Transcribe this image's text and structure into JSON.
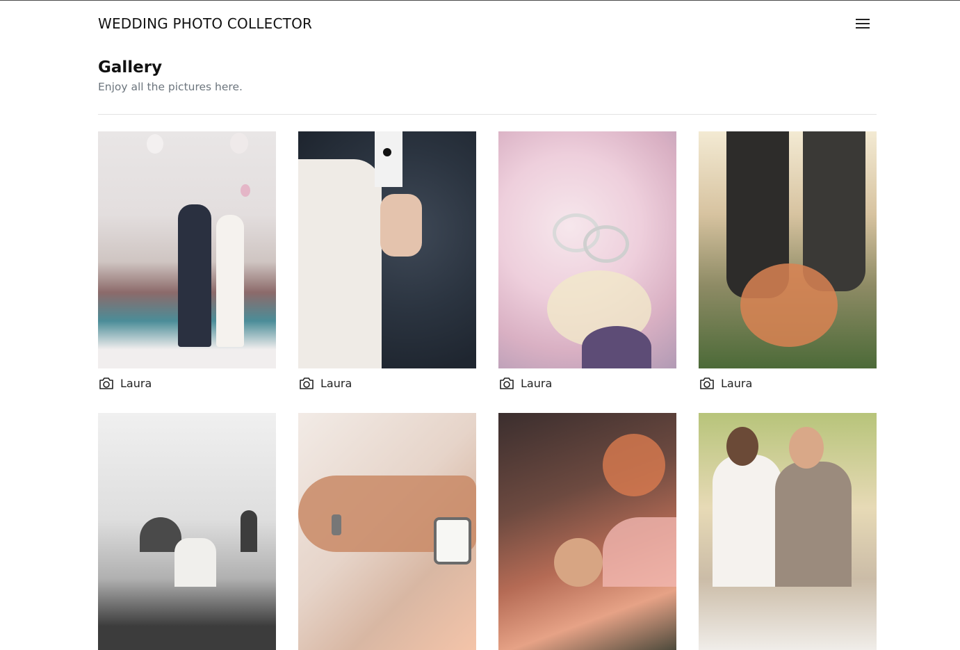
{
  "navbar": {
    "brand": "WEDDING PHOTO COLLECTOR",
    "menu_icon": "hamburger-menu-icon"
  },
  "header": {
    "title": "Gallery",
    "subtitle": "Enjoy all the pictures here."
  },
  "gallery": {
    "items": [
      {
        "author": "Laura",
        "icon": "camera-icon"
      },
      {
        "author": "Laura",
        "icon": "camera-icon"
      },
      {
        "author": "Laura",
        "icon": "camera-icon"
      },
      {
        "author": "Laura",
        "icon": "camera-icon"
      },
      {
        "author": "",
        "icon": "camera-icon"
      },
      {
        "author": "",
        "icon": "camera-icon"
      },
      {
        "author": "",
        "icon": "camera-icon"
      },
      {
        "author": "",
        "icon": "camera-icon"
      }
    ]
  }
}
